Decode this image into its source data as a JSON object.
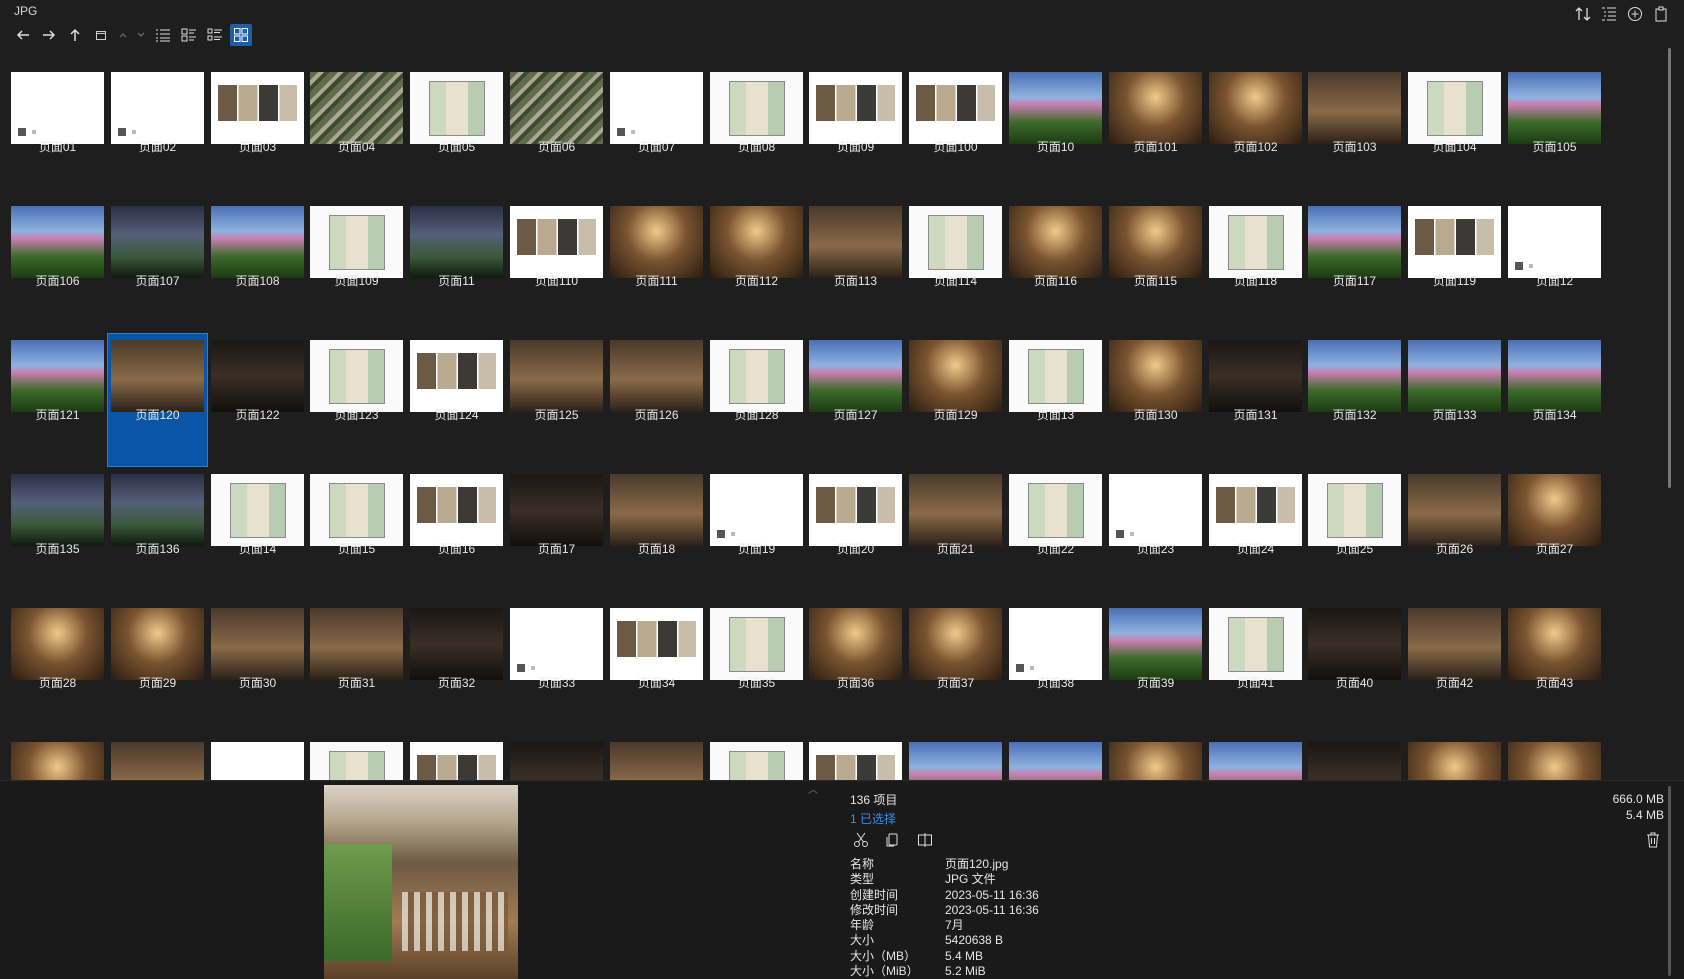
{
  "window": {
    "title": "JPG"
  },
  "summary": {
    "count": "136 项目",
    "selected": "1 已选择"
  },
  "sizes": {
    "total": "666.0 MB",
    "selected": "5.4 MB"
  },
  "properties": [
    {
      "key": "名称",
      "value": "页面120.jpg"
    },
    {
      "key": "类型",
      "value": "JPG 文件"
    },
    {
      "key": "创建时间",
      "value": "2023-05-11  16:36"
    },
    {
      "key": "修改时间",
      "value": "2023-05-11  16:36"
    },
    {
      "key": "年龄",
      "value": "7月"
    },
    {
      "key": "大小",
      "value": "5420638 B"
    },
    {
      "key": "大小（MB）",
      "value": "5.4 MB"
    },
    {
      "key": "大小（MiB）",
      "value": "5.2 MiB"
    }
  ],
  "tiles": [
    {
      "label": "页面01",
      "kind": "white"
    },
    {
      "label": "页面02",
      "kind": "white"
    },
    {
      "label": "页面03",
      "kind": "sheet"
    },
    {
      "label": "页面04",
      "kind": "aerial"
    },
    {
      "label": "页面05",
      "kind": "plan"
    },
    {
      "label": "页面06",
      "kind": "aerial"
    },
    {
      "label": "页面07",
      "kind": "white"
    },
    {
      "label": "页面08",
      "kind": "plan"
    },
    {
      "label": "页面09",
      "kind": "sheet"
    },
    {
      "label": "页面100",
      "kind": "sheet"
    },
    {
      "label": "页面10",
      "kind": "garden"
    },
    {
      "label": "页面101",
      "kind": "warm"
    },
    {
      "label": "页面102",
      "kind": "warm"
    },
    {
      "label": "页面103",
      "kind": "photo"
    },
    {
      "label": "页面104",
      "kind": "plan"
    },
    {
      "label": "页面105",
      "kind": "garden"
    },
    {
      "label": "页面106",
      "kind": "garden"
    },
    {
      "label": "页面107",
      "kind": "dusk"
    },
    {
      "label": "页面108",
      "kind": "garden"
    },
    {
      "label": "页面109",
      "kind": "plan"
    },
    {
      "label": "页面11",
      "kind": "dusk"
    },
    {
      "label": "页面110",
      "kind": "sheet"
    },
    {
      "label": "页面111",
      "kind": "warm"
    },
    {
      "label": "页面112",
      "kind": "warm"
    },
    {
      "label": "页面113",
      "kind": "photo"
    },
    {
      "label": "页面114",
      "kind": "plan"
    },
    {
      "label": "页面116",
      "kind": "warm"
    },
    {
      "label": "页面115",
      "kind": "warm"
    },
    {
      "label": "页面118",
      "kind": "plan"
    },
    {
      "label": "页面117",
      "kind": "garden"
    },
    {
      "label": "页面119",
      "kind": "sheet"
    },
    {
      "label": "页面12",
      "kind": "white"
    },
    {
      "label": "页面121",
      "kind": "garden"
    },
    {
      "label": "页面120",
      "kind": "photo"
    },
    {
      "label": "页面122",
      "kind": "dark"
    },
    {
      "label": "页面123",
      "kind": "plan"
    },
    {
      "label": "页面124",
      "kind": "sheet"
    },
    {
      "label": "页面125",
      "kind": "photo"
    },
    {
      "label": "页面126",
      "kind": "photo"
    },
    {
      "label": "页面128",
      "kind": "plan"
    },
    {
      "label": "页面127",
      "kind": "garden"
    },
    {
      "label": "页面129",
      "kind": "warm"
    },
    {
      "label": "页面13",
      "kind": "plan"
    },
    {
      "label": "页面130",
      "kind": "warm"
    },
    {
      "label": "页面131",
      "kind": "dark"
    },
    {
      "label": "页面132",
      "kind": "garden"
    },
    {
      "label": "页面133",
      "kind": "garden"
    },
    {
      "label": "页面134",
      "kind": "garden"
    },
    {
      "label": "页面135",
      "kind": "dusk"
    },
    {
      "label": "页面136",
      "kind": "dusk"
    },
    {
      "label": "页面14",
      "kind": "plan"
    },
    {
      "label": "页面15",
      "kind": "plan"
    },
    {
      "label": "页面16",
      "kind": "sheet"
    },
    {
      "label": "页面17",
      "kind": "dark"
    },
    {
      "label": "页面18",
      "kind": "photo"
    },
    {
      "label": "页面19",
      "kind": "white"
    },
    {
      "label": "页面20",
      "kind": "sheet"
    },
    {
      "label": "页面21",
      "kind": "photo"
    },
    {
      "label": "页面22",
      "kind": "plan"
    },
    {
      "label": "页面23",
      "kind": "white"
    },
    {
      "label": "页面24",
      "kind": "sheet"
    },
    {
      "label": "页面25",
      "kind": "plan"
    },
    {
      "label": "页面26",
      "kind": "photo"
    },
    {
      "label": "页面27",
      "kind": "warm"
    },
    {
      "label": "页面28",
      "kind": "warm"
    },
    {
      "label": "页面29",
      "kind": "warm"
    },
    {
      "label": "页面30",
      "kind": "photo"
    },
    {
      "label": "页面31",
      "kind": "photo"
    },
    {
      "label": "页面32",
      "kind": "dark"
    },
    {
      "label": "页面33",
      "kind": "white"
    },
    {
      "label": "页面34",
      "kind": "sheet"
    },
    {
      "label": "页面35",
      "kind": "plan"
    },
    {
      "label": "页面36",
      "kind": "warm"
    },
    {
      "label": "页面37",
      "kind": "warm"
    },
    {
      "label": "页面38",
      "kind": "white"
    },
    {
      "label": "页面39",
      "kind": "garden"
    },
    {
      "label": "页面41",
      "kind": "plan"
    },
    {
      "label": "页面40",
      "kind": "dark"
    },
    {
      "label": "页面42",
      "kind": "photo"
    },
    {
      "label": "页面43",
      "kind": "warm"
    },
    {
      "label": "",
      "kind": "warm"
    },
    {
      "label": "",
      "kind": "photo"
    },
    {
      "label": "",
      "kind": "white"
    },
    {
      "label": "",
      "kind": "plan"
    },
    {
      "label": "",
      "kind": "sheet"
    },
    {
      "label": "",
      "kind": "dark"
    },
    {
      "label": "",
      "kind": "photo"
    },
    {
      "label": "",
      "kind": "plan"
    },
    {
      "label": "",
      "kind": "sheet"
    },
    {
      "label": "",
      "kind": "garden"
    },
    {
      "label": "",
      "kind": "garden"
    },
    {
      "label": "",
      "kind": "warm"
    },
    {
      "label": "",
      "kind": "garden"
    },
    {
      "label": "",
      "kind": "dark"
    },
    {
      "label": "",
      "kind": "warm"
    },
    {
      "label": "",
      "kind": "warm"
    }
  ],
  "selected_index": 33,
  "colors": {
    "background": "#1e1e1e",
    "selection": "#0a55a6",
    "accent": "#3a8ee6"
  }
}
